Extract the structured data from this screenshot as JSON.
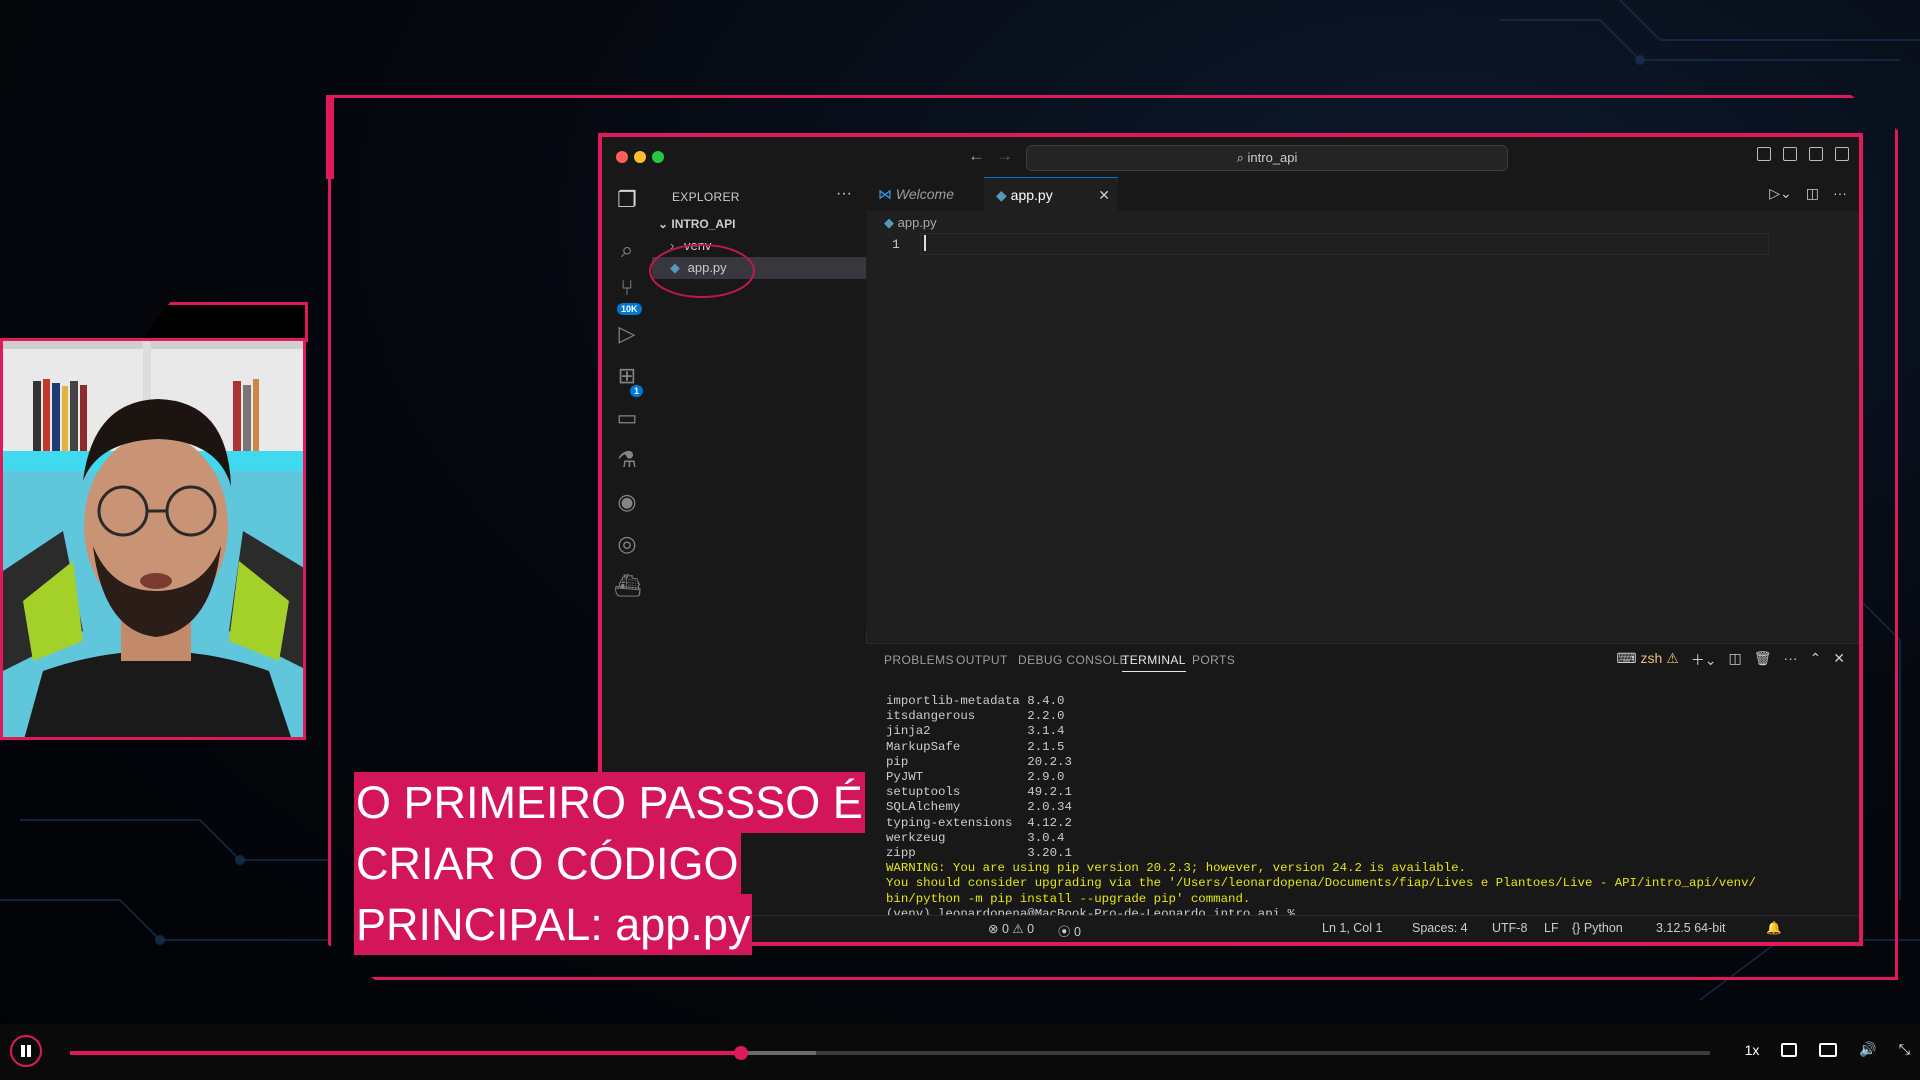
{
  "titlebar": {
    "search_text": "intro_api"
  },
  "explorer": {
    "header": "EXPLORER",
    "project": "INTRO_API",
    "items": [
      {
        "label": "venv",
        "kind": "folder"
      },
      {
        "label": "app.py",
        "kind": "file",
        "selected": true
      }
    ]
  },
  "activity_badges": {
    "source_control": "10K",
    "extensions": "1"
  },
  "tabs": [
    {
      "label": "Welcome",
      "active": false
    },
    {
      "label": "app.py",
      "active": true
    }
  ],
  "editor": {
    "breadcrumb": "app.py",
    "line_number": "1"
  },
  "panel": {
    "tabs": [
      "PROBLEMS",
      "OUTPUT",
      "DEBUG CONSOLE",
      "TERMINAL",
      "PORTS"
    ],
    "active_tab": "TERMINAL",
    "shell": "zsh",
    "terminal_lines": [
      {
        "text": "importlib-metadata 8.4.0",
        "warn": false
      },
      {
        "text": "itsdangerous       2.2.0",
        "warn": false
      },
      {
        "text": "jinja2             3.1.4",
        "warn": false
      },
      {
        "text": "MarkupSafe         2.1.5",
        "warn": false
      },
      {
        "text": "pip                20.2.3",
        "warn": false
      },
      {
        "text": "PyJWT              2.9.0",
        "warn": false
      },
      {
        "text": "setuptools         49.2.1",
        "warn": false
      },
      {
        "text": "SQLAlchemy         2.0.34",
        "warn": false
      },
      {
        "text": "typing-extensions  4.12.2",
        "warn": false
      },
      {
        "text": "werkzeug           3.0.4",
        "warn": false
      },
      {
        "text": "zipp               3.20.1",
        "warn": false
      },
      {
        "text": "WARNING: You are using pip version 20.2.3; however, version 24.2 is available.",
        "warn": true
      },
      {
        "text": "You should consider upgrading via the '/Users/leonardopena/Documents/fiap/Lives e Plantoes/Live - API/intro_api/venv/",
        "warn": true
      },
      {
        "text": "bin/python -m pip install --upgrade pip' command.",
        "warn": true
      },
      {
        "text": "(venv) leonardopena@MacBook-Pro-de-Leonardo intro_api % ",
        "warn": false
      }
    ]
  },
  "statusbar": {
    "errors": "0",
    "warnings": "0",
    "ports": "0",
    "position": "Ln 1, Col 1",
    "spaces": "Spaces: 4",
    "encoding": "UTF-8",
    "eol": "LF",
    "language": "Python",
    "interpreter": "3.12.5 64-bit"
  },
  "caption": {
    "lines": [
      "O PRIMEIRO PASSSO É",
      "CRIAR O CÓDIGO",
      "PRINCIPAL: app.py"
    ]
  },
  "player": {
    "progress": 0.409,
    "buffered": 0.455,
    "speed": "1x",
    "colors": {
      "accent": "#e0195a"
    }
  },
  "colors": {
    "frame": "#e0195a",
    "caption_bg": "#d3165a",
    "vscode_bg": "#1f1f1f"
  }
}
